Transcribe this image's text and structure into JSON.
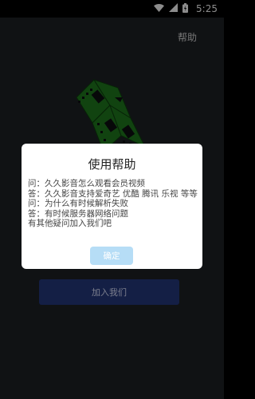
{
  "status_bar": {
    "time": "5:25",
    "icons": [
      "wifi-icon",
      "signal-icon",
      "battery-icon"
    ]
  },
  "header": {
    "help_link": "帮助"
  },
  "main": {
    "join_button": "加入我们"
  },
  "dialog": {
    "title": "使用帮助",
    "lines": [
      "问：久久影音怎么观看会员视频",
      "答：久久影音支持爱奇艺 优酷 腾讯 乐视 等等",
      "问：为什么有时候解析失败",
      "答：有时候服务器网络问题",
      "有其他疑问加入我们吧"
    ],
    "ok_button": "确定"
  },
  "colors": {
    "accent_button": "#25397f",
    "ok_button": "#b6ddf6",
    "logo_green": "#1f7a1e"
  }
}
